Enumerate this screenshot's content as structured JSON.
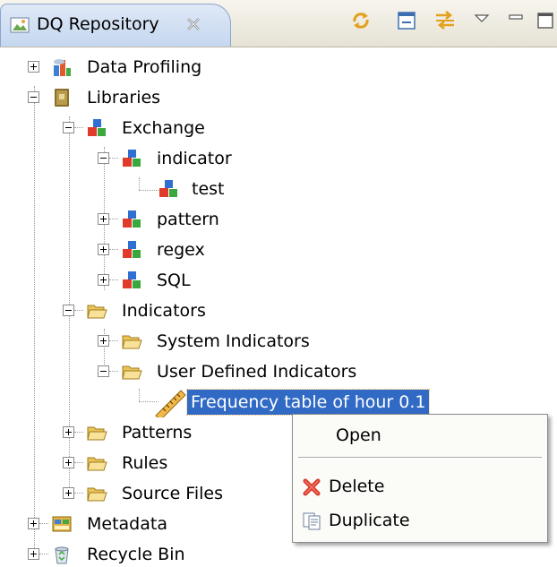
{
  "view": {
    "title": "DQ Repository",
    "icons": {
      "tab": "repository-icon",
      "close": "close-icon",
      "sync": "link-with-editor-icon",
      "collapse": "collapse-all-icon",
      "filter": "filter-icon",
      "menu": "view-menu-icon",
      "minimize": "minimize-icon",
      "maximize": "maximize-icon"
    }
  },
  "tree": {
    "data_profiling": "Data Profiling",
    "libraries": "Libraries",
    "exchange": "Exchange",
    "indicator": "indicator",
    "test": "test",
    "pattern": "pattern",
    "regex": "regex",
    "sql": "SQL",
    "indicators": "Indicators",
    "system_indicators": "System Indicators",
    "user_defined_indicators": "User Defined Indicators",
    "frequency_table": "Frequency table of hour 0.1",
    "patterns": "Patterns",
    "rules": "Rules",
    "source_files": "Source Files",
    "metadata": "Metadata",
    "recycle_bin": "Recycle Bin"
  },
  "context_menu": {
    "open": "Open",
    "delete": "Delete",
    "duplicate": "Duplicate"
  },
  "colors": {
    "selection": "#316ac5",
    "tab_fill": "#c5d7f0",
    "folder": "#f3d36b"
  }
}
